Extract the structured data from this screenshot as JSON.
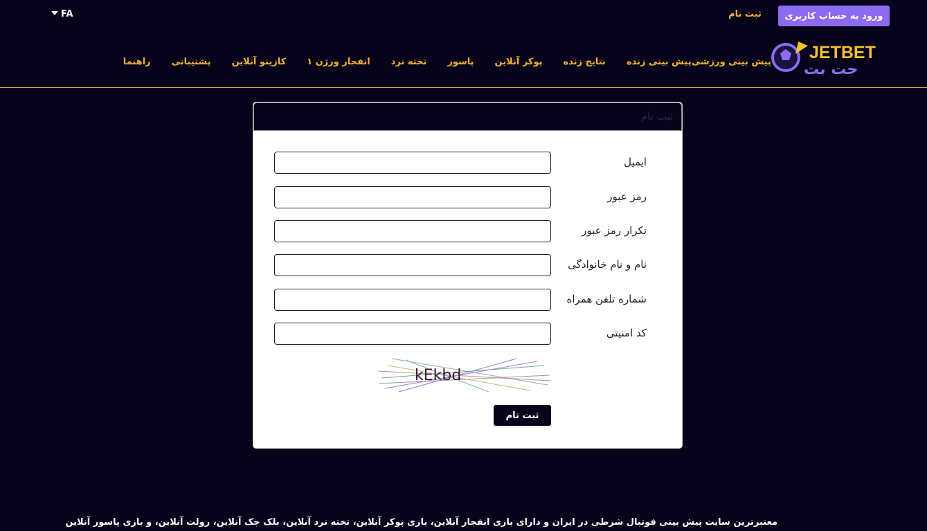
{
  "header": {
    "language": "FA",
    "login_button": "ورود به حساب کاربری",
    "signup_link": "ثبت نام",
    "logo": {
      "latin": "JETBET",
      "persian": "جت بت"
    },
    "nav": [
      "پیش بینی ورزشی",
      "پیش بینی زنده",
      "نتایج زنده",
      "پوکر آنلاین",
      "پاسور",
      "تخته نرد",
      "انفجار ورژن ۱",
      "کازینو آنلاین",
      "پشتیبانی",
      "راهنما"
    ]
  },
  "form": {
    "title": "ثبت نام",
    "fields": [
      {
        "label": "ایمیل",
        "value": ""
      },
      {
        "label": "رمز عبور",
        "value": ""
      },
      {
        "label": "تکرار رمز عبور",
        "value": ""
      },
      {
        "label": "نام و نام خانوادگی",
        "value": ""
      },
      {
        "label": "شماره تلفن همراه",
        "value": ""
      },
      {
        "label": "کد امنیتی",
        "value": ""
      }
    ],
    "captcha_text": "kEkbd",
    "submit": "ثبت نام"
  },
  "footer": {
    "text": "معتبرترین سایت پیش بینی فوتبال شرطی در ایران و دارای بازی انفجار آنلاین، بازی پوکر آنلاین، تخته نرد آنلاین، بلک جک آنلاین، رولت آنلاین، و بازی پاسور آنلاین"
  },
  "colors": {
    "background": "#07031a",
    "accent": "#f2b233",
    "primary_button": "#8b6cf0"
  }
}
